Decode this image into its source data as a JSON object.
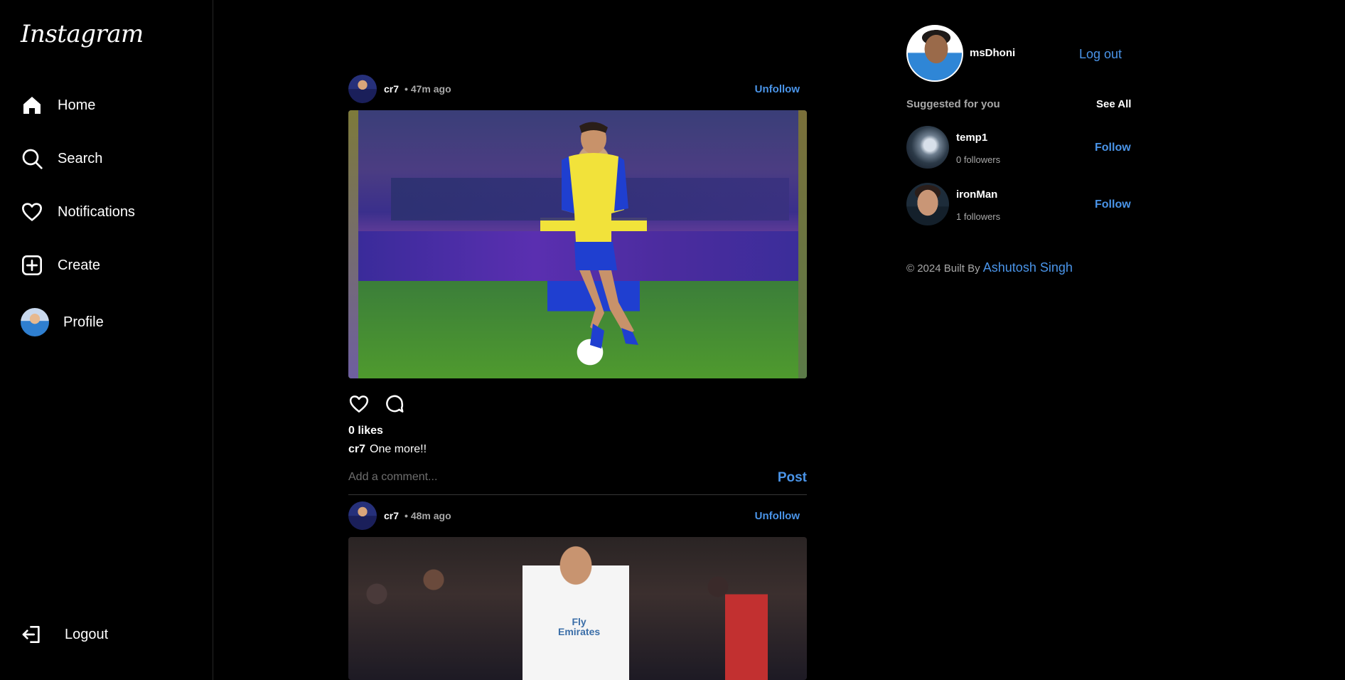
{
  "sidebar": {
    "logo": "Instagram",
    "items": [
      {
        "label": "Home",
        "icon": "home-icon"
      },
      {
        "label": "Search",
        "icon": "search-icon"
      },
      {
        "label": "Notifications",
        "icon": "heart-icon"
      },
      {
        "label": "Create",
        "icon": "plus-square-icon"
      },
      {
        "label": "Profile",
        "icon": "avatar"
      }
    ],
    "logout": {
      "label": "Logout",
      "icon": "logout-icon"
    }
  },
  "feed": {
    "posts": [
      {
        "user": "cr7",
        "time": "• 47m ago",
        "action": "Unfollow",
        "likes": "0 likes",
        "caption_user": "cr7",
        "caption_text": "One more!!",
        "comment_placeholder": "Add a comment...",
        "post_button": "Post"
      },
      {
        "user": "cr7",
        "time": "• 48m ago",
        "action": "Unfollow",
        "shirt_text": "Fly\nEmirates"
      }
    ]
  },
  "right_panel": {
    "current_user": "msDhoni",
    "logout_label": "Log out",
    "suggested_title": "Suggested for you",
    "see_all": "See All",
    "suggestions": [
      {
        "name": "temp1",
        "followers": "0 followers",
        "action": "Follow"
      },
      {
        "name": "ironMan",
        "followers": "1 followers",
        "action": "Follow"
      }
    ],
    "footer_prefix": "© 2024 Built By",
    "footer_author": "Ashutosh Singh"
  },
  "colors": {
    "background": "#000000",
    "accent": "#4a94e8",
    "muted": "#a8a8a8",
    "divider": "#262626"
  }
}
